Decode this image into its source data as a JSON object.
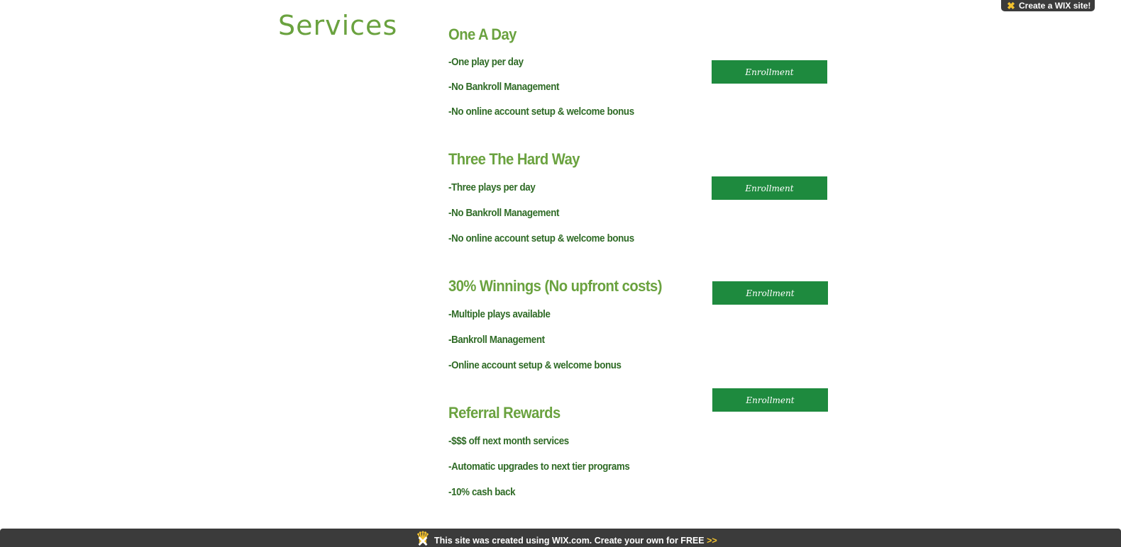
{
  "page": {
    "title": "Services"
  },
  "wix_badge": {
    "label": "Create a WIX site!"
  },
  "services": [
    {
      "title": "One A Day",
      "items": [
        "-One play per day",
        "-No Bankroll Management",
        "-No online account setup & welcome bonus"
      ],
      "button_label": "Enrollment"
    },
    {
      "title": "Three The Hard Way",
      "items": [
        "-Three plays per day",
        "-No Bankroll Management",
        "-No online account setup & welcome bonus"
      ],
      "button_label": "Enrollment"
    },
    {
      "title": "30% Winnings  (No upfront costs)",
      "items": [
        "-Multiple plays available",
        "-Bankroll Management",
        "-Online account setup & welcome bonus"
      ],
      "button_label": "Enrollment"
    },
    {
      "title": "Referral Rewards",
      "items": [
        "-$$$ off next month services",
        "-Automatic upgrades to next tier programs",
        "-10% cash back"
      ],
      "button_label": "Enrollment"
    }
  ],
  "footer": {
    "text": "This site was created using WIX.com. Create your own for FREE",
    "link_arrows": ">>"
  },
  "colors": {
    "title_green": "#6aa23f",
    "item_green": "#2f6b26",
    "button_green": "#1e8a3e",
    "wix_dark": "#3b3b3b",
    "wix_yellow": "#f2c12e"
  }
}
